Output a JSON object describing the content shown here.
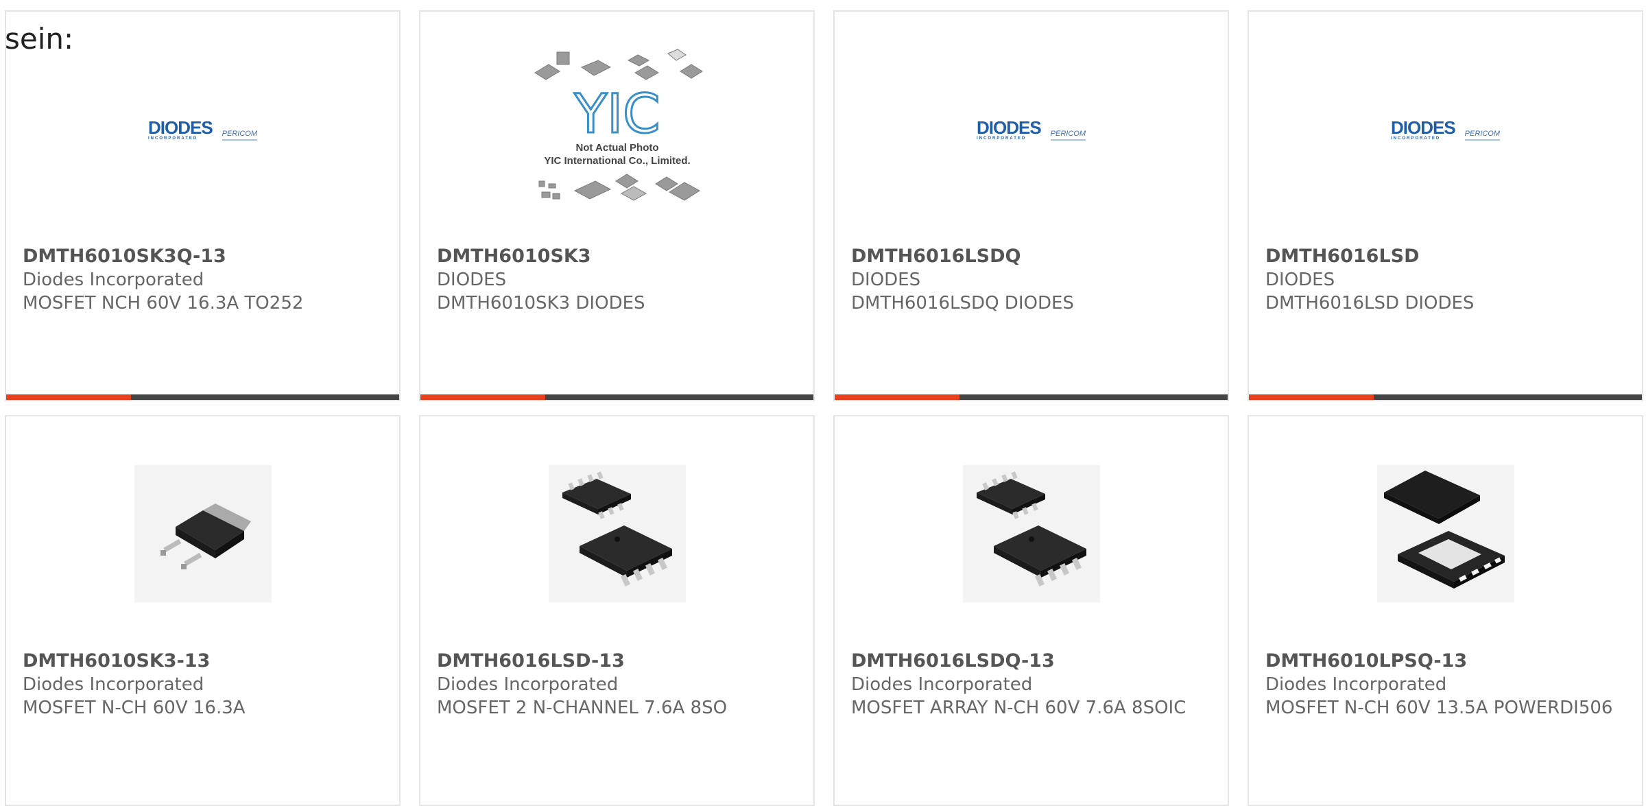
{
  "lead_text": "sein:",
  "accent_color": "#e8401c",
  "products": [
    {
      "part": "DMTH6010SK3Q-13",
      "manufacturer": "Diodes Incorporated",
      "description": "MOSFET NCH 60V 16.3A TO252",
      "image": "diodes-logo",
      "logo_text": "DIODES",
      "logo_sub": "INCORPORATED",
      "logo_pericom": "PERICOM"
    },
    {
      "part": "DMTH6010SK3",
      "manufacturer": "DIODES",
      "description": "DMTH6010SK3 DIODES",
      "image": "yic-placeholder",
      "placeholder_line1": "Not Actual Photo",
      "placeholder_line2": "YIC International Co., Limited."
    },
    {
      "part": "DMTH6016LSDQ",
      "manufacturer": "DIODES",
      "description": "DMTH6016LSDQ DIODES",
      "image": "diodes-logo",
      "logo_text": "DIODES",
      "logo_sub": "INCORPORATED",
      "logo_pericom": "PERICOM"
    },
    {
      "part": "DMTH6016LSD",
      "manufacturer": "DIODES",
      "description": "DMTH6016LSD DIODES",
      "image": "diodes-logo",
      "logo_text": "DIODES",
      "logo_sub": "INCORPORATED",
      "logo_pericom": "PERICOM"
    },
    {
      "part": "DMTH6010SK3-13",
      "manufacturer": "Diodes Incorporated",
      "description": "MOSFET N-CH 60V 16.3A",
      "image": "to252-chip"
    },
    {
      "part": "DMTH6016LSD-13",
      "manufacturer": "Diodes Incorporated",
      "description": "MOSFET 2 N-CHANNEL 7.6A 8SO",
      "image": "so8-chips"
    },
    {
      "part": "DMTH6016LSDQ-13",
      "manufacturer": "Diodes Incorporated",
      "description": "MOSFET ARRAY N-CH 60V 7.6A 8SOIC",
      "image": "so8-chips"
    },
    {
      "part": "DMTH6010LPSQ-13",
      "manufacturer": "Diodes Incorporated",
      "description": "MOSFET N-CH 60V 13.5A POWERDI506",
      "image": "powerdi-chips"
    }
  ]
}
